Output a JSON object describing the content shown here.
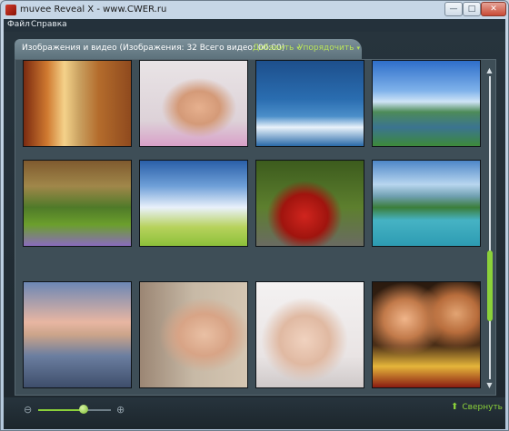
{
  "window": {
    "title": "muvee Reveal X - www.CWER.ru",
    "controls": {
      "minimize": "—",
      "maximize": "□",
      "close": "✕"
    }
  },
  "menu": [
    "Файл",
    "Справка"
  ],
  "tab": {
    "title": "Изображения и видео   (Изображения: 32   Всего видео: 00:00)",
    "add_label": "Добавить",
    "sort_label": "Упорядочить",
    "caret": "▾"
  },
  "gallery": {
    "thumbnails": [
      {
        "icon": "photo-euro-banknotes"
      },
      {
        "icon": "photo-woman-pink"
      },
      {
        "icon": "photo-dolphin"
      },
      {
        "icon": "photo-windmill-lake"
      },
      {
        "icon": "photo-forest-flowers"
      },
      {
        "icon": "photo-sky-field"
      },
      {
        "icon": "photo-red-sports-car"
      },
      {
        "icon": "photo-mountain-lake"
      },
      {
        "icon": "photo-sailboats-sunset"
      },
      {
        "icon": "photo-woman-bikini"
      },
      {
        "icon": "photo-woman-lingerie"
      },
      {
        "icon": "photo-couple-popcorn"
      }
    ]
  },
  "scrollbar": {
    "up": "▲",
    "down": "▼",
    "position": 0.75
  },
  "zoom": {
    "out_icon": "⊖",
    "in_icon": "⊕",
    "level": 0.62
  },
  "footer": {
    "collapse_label": "Свернуть",
    "collapse_icon": "⬆"
  },
  "colors": {
    "accent": "#8bd13a",
    "panel": "#3e4e57",
    "background": "#1d272e"
  }
}
